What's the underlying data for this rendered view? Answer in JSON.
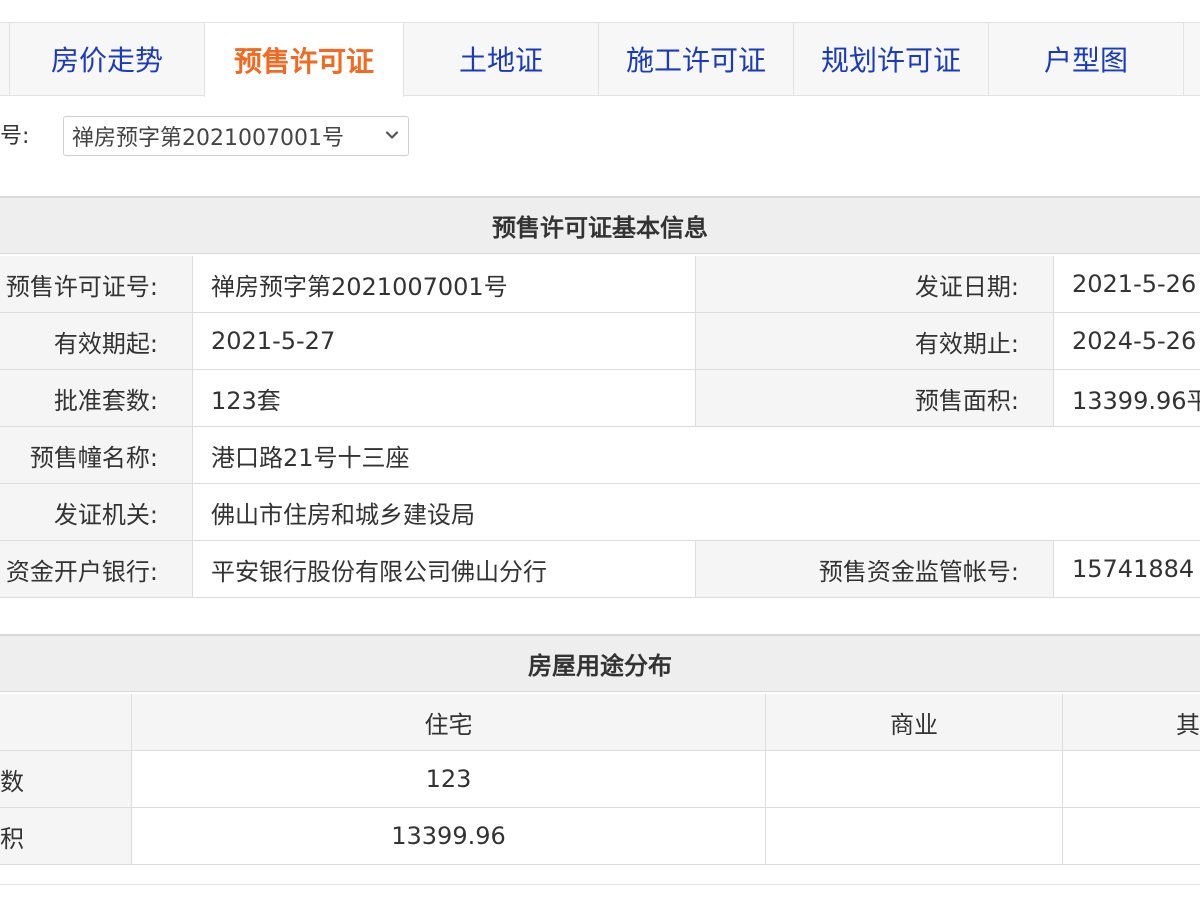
{
  "tabs": [
    {
      "label": "房价走势",
      "active": false
    },
    {
      "label": "预售许可证",
      "active": true
    },
    {
      "label": "土地证",
      "active": false
    },
    {
      "label": "施工许可证",
      "active": false
    },
    {
      "label": "规划许可证",
      "active": false
    },
    {
      "label": "户型图",
      "active": false
    }
  ],
  "permit_select": {
    "label": "号:",
    "value": "禅房预字第2021007001号"
  },
  "basic_info": {
    "title": "预售许可证基本信息",
    "permit_no_label": "预售许可证号:",
    "permit_no": "禅房预字第2021007001号",
    "issue_date_label": "发证日期:",
    "issue_date": "2021-5-26",
    "valid_from_label": "有效期起:",
    "valid_from": "2021-5-27",
    "valid_to_label": "有效期止:",
    "valid_to": "2024-5-26",
    "units_label": "批准套数:",
    "units": "123套",
    "area_label": "预售面积:",
    "area": "13399.96平",
    "building_label": "预售幢名称:",
    "building": "港口路21号十三座",
    "authority_label": "发证机关:",
    "authority": "佛山市住房和城乡建设局",
    "bank_label": "资金开户银行:",
    "bank": "平安银行股份有限公司佛山分行",
    "account_label": "预售资金监管帐号:",
    "account": "15741884"
  },
  "usage": {
    "title": "房屋用途分布",
    "columns": [
      "",
      "住宅",
      "商业",
      "其"
    ],
    "rows": [
      {
        "label": "数",
        "values": [
          "123",
          "",
          ""
        ]
      },
      {
        "label": "积",
        "values": [
          "13399.96",
          "",
          ""
        ]
      }
    ]
  },
  "colors": {
    "tab_text": "#1a3bbd",
    "tab_active_text": "#f26a21",
    "header_bg": "#eeeeee",
    "label_bg": "#f5f5f5"
  }
}
